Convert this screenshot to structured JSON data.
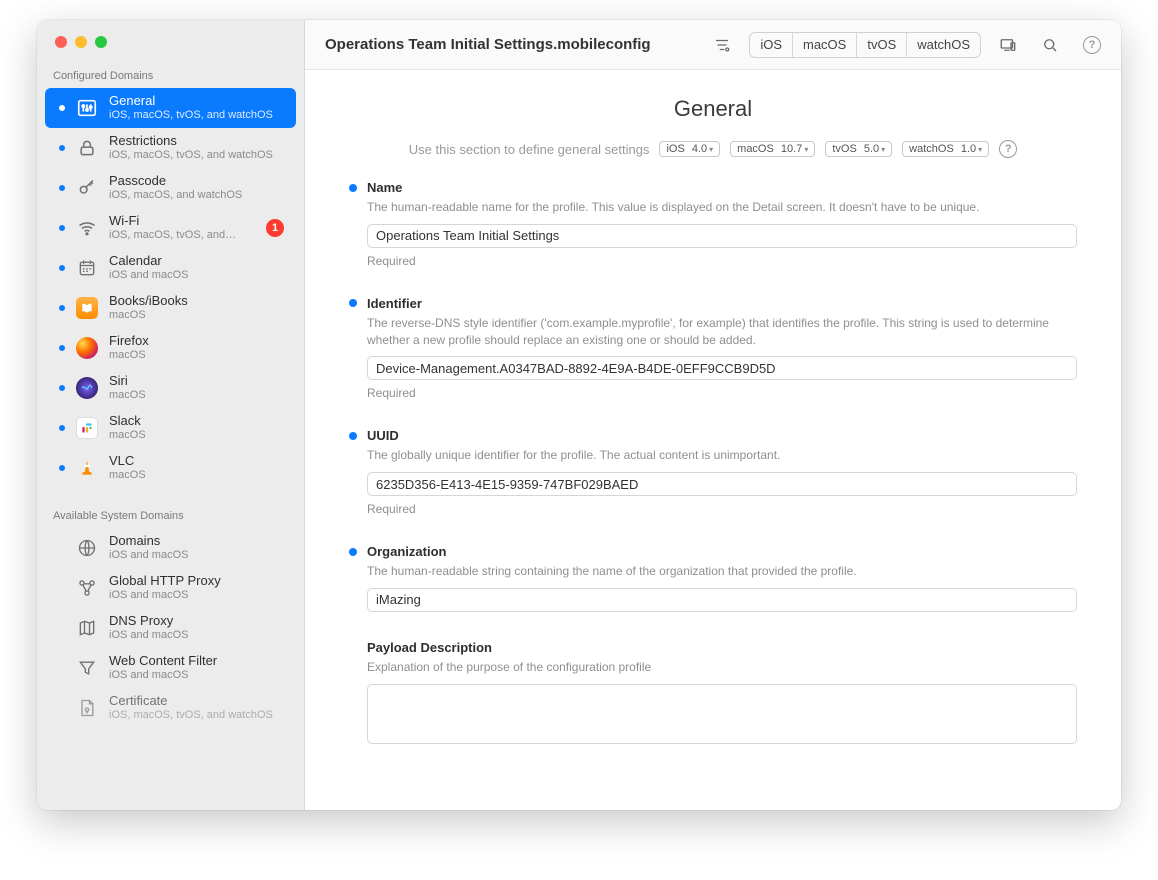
{
  "window_title": "Operations Team Initial Settings.mobileconfig",
  "toolbar_segments": [
    "iOS",
    "macOS",
    "tvOS",
    "watchOS"
  ],
  "sidebar": {
    "section1_header": "Configured Domains",
    "configured": [
      {
        "title": "General",
        "sub": "iOS, macOS, tvOS, and watchOS",
        "active": true
      },
      {
        "title": "Restrictions",
        "sub": "iOS, macOS, tvOS, and watchOS"
      },
      {
        "title": "Passcode",
        "sub": "iOS, macOS, and watchOS"
      },
      {
        "title": "Wi-Fi",
        "sub": "iOS, macOS, tvOS, and…",
        "badge": "1"
      },
      {
        "title": "Calendar",
        "sub": "iOS and macOS"
      },
      {
        "title": "Books/iBooks",
        "sub": "macOS"
      },
      {
        "title": "Firefox",
        "sub": "macOS"
      },
      {
        "title": "Siri",
        "sub": "macOS"
      },
      {
        "title": "Slack",
        "sub": "macOS"
      },
      {
        "title": "VLC",
        "sub": "macOS"
      }
    ],
    "section2_header": "Available System Domains",
    "available": [
      {
        "title": "Domains",
        "sub": "iOS and macOS"
      },
      {
        "title": "Global HTTP Proxy",
        "sub": "iOS and macOS"
      },
      {
        "title": "DNS Proxy",
        "sub": "iOS and macOS"
      },
      {
        "title": "Web Content Filter",
        "sub": "iOS and macOS"
      },
      {
        "title": "Certificate",
        "sub": "iOS, macOS, tvOS, and watchOS"
      }
    ]
  },
  "page": {
    "title": "General",
    "subtitle": "Use this section to define general settings",
    "os_badges": [
      {
        "name": "iOS",
        "ver": "4.0"
      },
      {
        "name": "macOS",
        "ver": "10.7"
      },
      {
        "name": "tvOS",
        "ver": "5.0"
      },
      {
        "name": "watchOS",
        "ver": "1.0"
      }
    ]
  },
  "form": {
    "name": {
      "label": "Name",
      "desc": "The human-readable name for the profile. This value is displayed on the Detail screen. It doesn't have to be unique.",
      "value": "Operations Team Initial Settings",
      "required": "Required"
    },
    "identifier": {
      "label": "Identifier",
      "desc": "The reverse-DNS style identifier ('com.example.myprofile', for example) that identifies the profile. This string is used to determine whether a new profile should replace an existing one or should be added.",
      "value": "Device-Management.A0347BAD-8892-4E9A-B4DE-0EFF9CCB9D5D",
      "required": "Required"
    },
    "uuid": {
      "label": "UUID",
      "desc": "The globally unique identifier for the profile. The actual content is unimportant.",
      "value": "6235D356-E413-4E15-9359-747BF029BAED",
      "required": "Required"
    },
    "organization": {
      "label": "Organization",
      "desc": "The human-readable string containing the name of the organization that provided the profile.",
      "value": "iMazing"
    },
    "payload_description": {
      "label": "Payload Description",
      "desc": "Explanation of the purpose of the configuration profile",
      "value": ""
    }
  }
}
